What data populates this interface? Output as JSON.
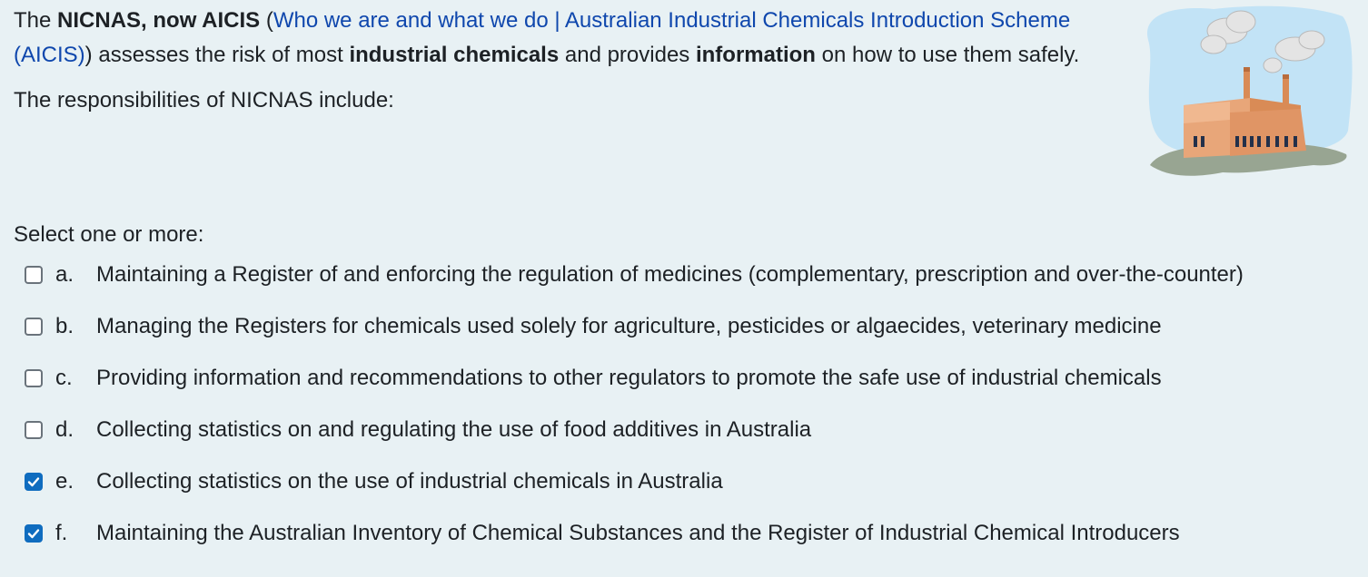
{
  "question": {
    "intro_the": "The ",
    "bold_org": "NICNAS, now AICIS",
    "paren_open": " (",
    "link_text": "Who we are and what we do | Australian Industrial Chemicals Introduction Scheme (AICIS)",
    "paren_close": ")",
    "text_assesses": " assesses the risk of most ",
    "bold_chemicals": "industrial chemicals",
    "text_provides": " and provides ",
    "bold_information": "information",
    "text_end": " on how to use them safely.",
    "responsibilities": "The responsibilities of NICNAS include:"
  },
  "image": {
    "icon": "factory-clipart"
  },
  "prompt": "Select one or more:",
  "options": [
    {
      "letter": "a.",
      "text": "Maintaining a Register of and enforcing the regulation of medicines (complementary, prescription and over-the-counter)",
      "checked": false
    },
    {
      "letter": "b.",
      "text": "Managing the Registers for chemicals used solely for agriculture, pesticides or algaecides, veterinary medicine",
      "checked": false
    },
    {
      "letter": "c.",
      "text": "Providing information and recommendations to other regulators to promote the safe use of industrial chemicals",
      "checked": false
    },
    {
      "letter": "d.",
      "text": "Collecting statistics on and regulating the use of food additives in Australia",
      "checked": false
    },
    {
      "letter": "e.",
      "text": "Collecting statistics on the use of industrial chemicals in Australia",
      "checked": true
    },
    {
      "letter": "f.",
      "text": "Maintaining the Australian Inventory of Chemical Substances and the Register of Industrial Chemical Introducers",
      "checked": true
    }
  ],
  "colors": {
    "background": "#e8f1f4",
    "link": "#0f47ad",
    "checkbox_checked": "#0f6cbf"
  }
}
